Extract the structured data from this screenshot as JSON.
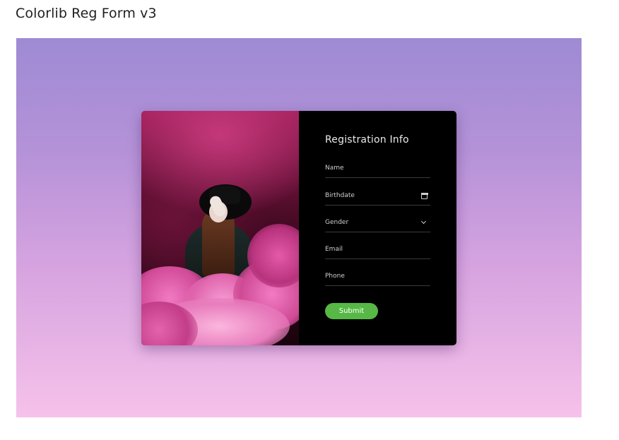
{
  "page": {
    "title": "Colorlib Reg Form v3"
  },
  "colors": {
    "stage_gradient_top": "#9e8bd4",
    "stage_gradient_bottom": "#f6c2ea",
    "form_background": "#000000",
    "submit_button": "#57b846"
  },
  "form": {
    "title": "Registration Info",
    "fields": {
      "name": {
        "placeholder": "Name"
      },
      "birthdate": {
        "placeholder": "Birthdate",
        "icon": "calendar-icon"
      },
      "gender": {
        "placeholder": "Gender",
        "icon": "chevron-down-icon"
      },
      "email": {
        "placeholder": "Email"
      },
      "phone": {
        "placeholder": "Phone"
      }
    },
    "submit_label": "Submit"
  },
  "image": {
    "subject": "woman-in-hat-pink-smoke-photo"
  }
}
